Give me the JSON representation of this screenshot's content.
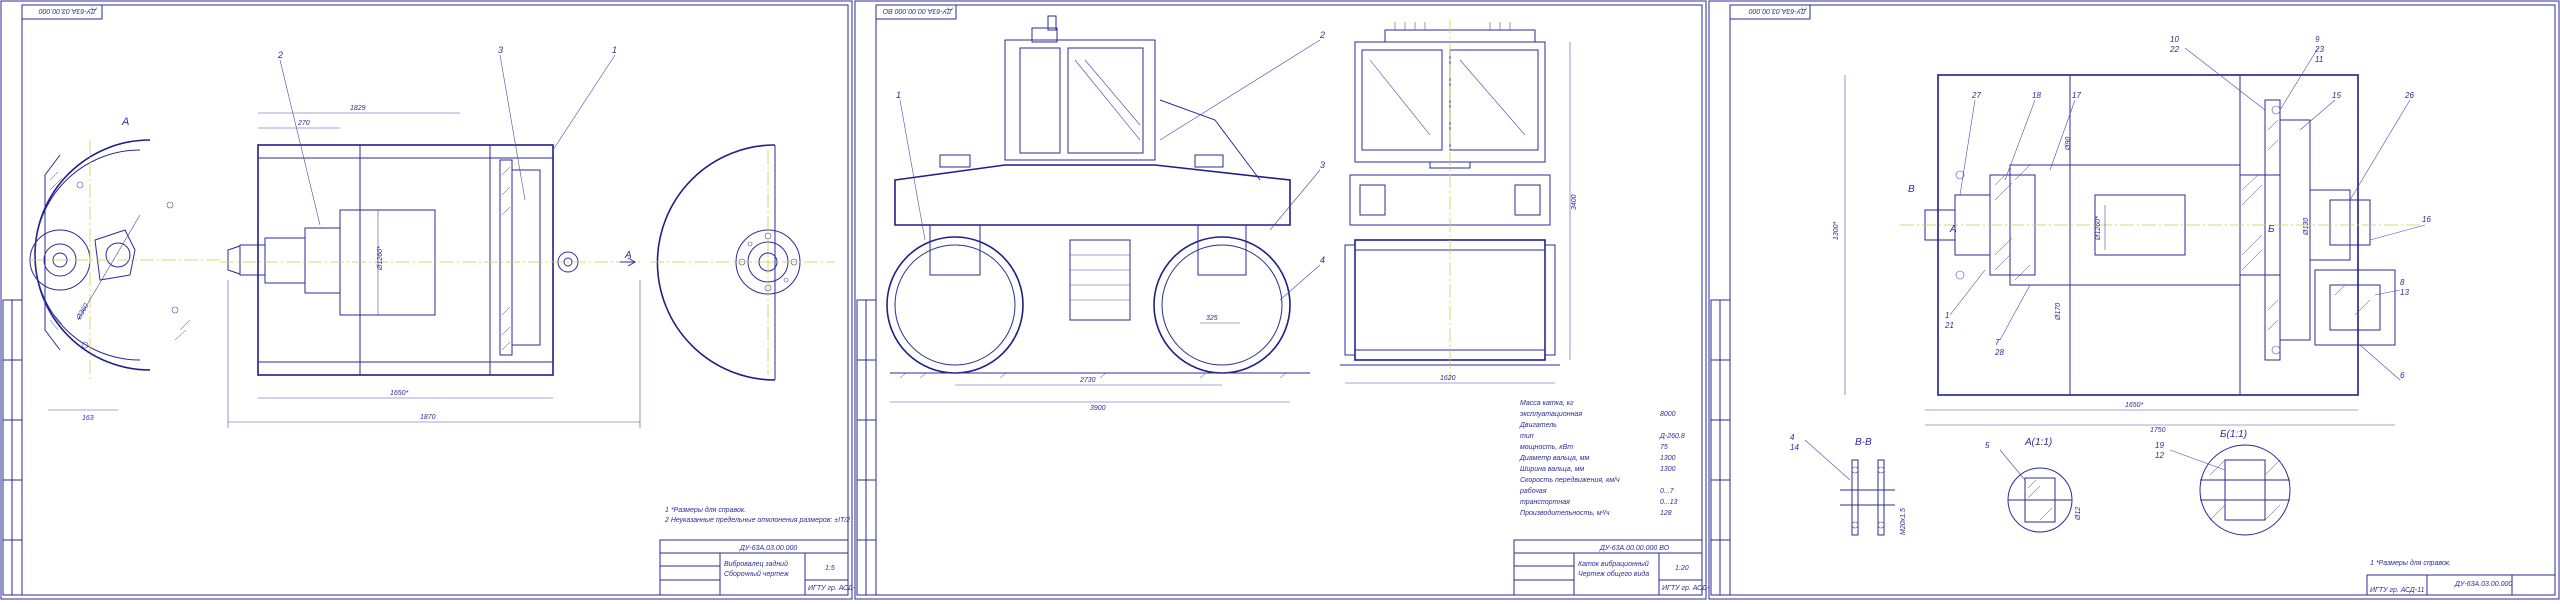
{
  "colors": {
    "line": "#2b2b9a",
    "axis": "#d6c94a",
    "paper": "#ffffff"
  },
  "sheet1": {
    "corner_code": "ДУ-63А.03.00.000",
    "view_label": "А",
    "arrow_label": "А",
    "callouts": [
      "2",
      "3",
      "1"
    ],
    "dims": [
      "1829",
      "270",
      "Ø1260*",
      "1650*",
      "1870",
      "Ø360",
      "163",
      "1"
    ],
    "notes": [
      "1 *Размеры для справок.",
      "2 Неуказанные предельные отклонения размеров: ±IT/2"
    ],
    "title_code": "ДУ-63А.03.00.000",
    "title_name": [
      "Вибровалец задний",
      "Сборочный чертеж"
    ],
    "scale": "1:5",
    "group": "ИГТУ гр. АСД-11"
  },
  "sheet2": {
    "corner_code": "ДУ-63А.00.00.000 ВО",
    "callouts": [
      "1",
      "2",
      "3",
      "4"
    ],
    "dims": [
      "2730",
      "3900",
      "1620",
      "3400",
      "325"
    ],
    "specs": [
      {
        "label": "Масса катка, кг",
        "value": ""
      },
      {
        "label": "эксплуатационная",
        "value": "8000"
      },
      {
        "label": "Двигатель",
        "value": ""
      },
      {
        "label": "тип",
        "value": "Д-260.8"
      },
      {
        "label": "мощность, кВт",
        "value": "75"
      },
      {
        "label": "Диаметр вальца, мм",
        "value": "1300"
      },
      {
        "label": "Ширина вальца, мм",
        "value": "1300"
      },
      {
        "label": "Скорость передвижения, км/ч",
        "value": ""
      },
      {
        "label": "рабочая",
        "value": "0...7"
      },
      {
        "label": "транспортная",
        "value": "0...13"
      },
      {
        "label": "Производительность, м³/ч",
        "value": "128"
      }
    ],
    "title_code": "ДУ-63А.00.00.000 ВО",
    "title_name": [
      "Каток вибрационный",
      "Чертеж общего вида"
    ],
    "scale": "1:20",
    "group": "ИГТУ гр. АСД-11"
  },
  "sheet3": {
    "corner_code": "ДУ-63А.03.00.000",
    "section_labels": [
      "В-В",
      "А(1:1)",
      "Б(1:1)"
    ],
    "callouts": [
      "10",
      "22",
      "9",
      "23",
      "11",
      "27",
      "18",
      "17",
      "15",
      "26",
      "16",
      "8",
      "13",
      "6",
      "7",
      "28",
      "1",
      "21",
      "4",
      "14",
      "5",
      "19",
      "12"
    ],
    "dims": [
      "1650*",
      "1750",
      "Ø1260*",
      "1300*",
      "Ø170",
      "Ø90",
      "Ø130",
      "M20x1.5",
      "Ø12"
    ],
    "markers": [
      "В",
      "А",
      "Б"
    ],
    "note": "1 *Размеры для справок.",
    "title_code": "ДУ-63А.03.00.000",
    "group": "ИГТУ гр. АСД-11"
  }
}
